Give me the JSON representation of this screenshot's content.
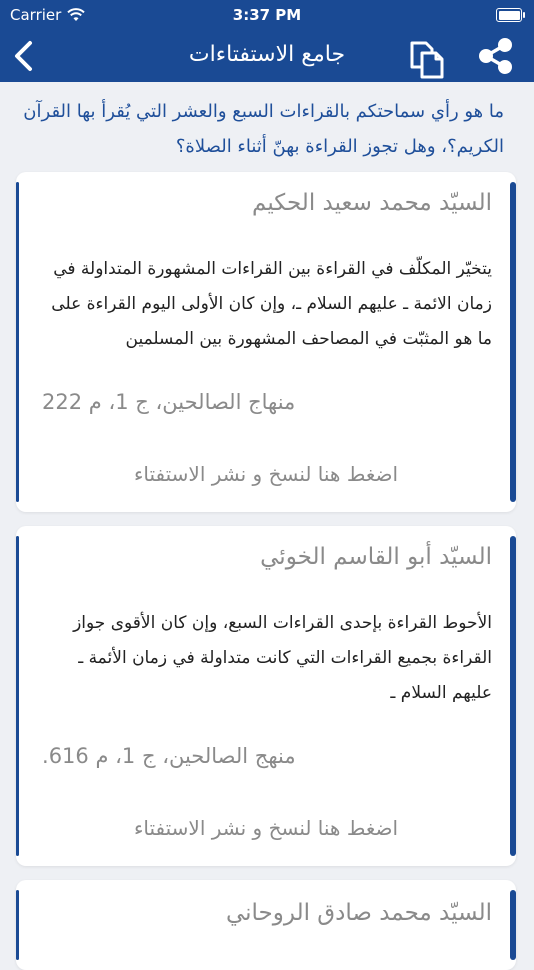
{
  "status": {
    "carrier": "Carrier",
    "time": "3:37 PM"
  },
  "nav": {
    "title": "جامع الاستفتاءات"
  },
  "question": "ما هو رأي سماحتكم بالقراءات السبع والعشر التي يُقرأ بها القرآن الكريم؟، وهل تجوز القراءة بهنّ أثناء الصلاة؟",
  "cards": [
    {
      "scholar": "السيّد محمد سعيد الحكيم",
      "answer": "يتخيّر المكلّف في القراءة بين القراءات المشهورة المتداولة في زمان الائمة ـ عليهم السلام ـ، وإن كان الأولى اليوم القراءة على ما هو المثبّت في المصاحف المشهورة بين المسلمين",
      "source": "منهاج الصالحين، ج 1، م 222",
      "copy_label": "اضغط هنا لنسخ و نشر الاستفتاء"
    },
    {
      "scholar": "السيّد أبو القاسم الخوئي",
      "answer": "الأحوط القراءة بإحدى القراءات السبع، وإن كان الأقوى جواز القراءة بجميع القراءات التي كانت متداولة في زمان الأئمة ـ عليهم السلام ـ",
      "source": "منهج الصالحين، ج 1، م 616.",
      "copy_label": "اضغط هنا لنسخ و نشر الاستفتاء"
    },
    {
      "scholar": "السيّد محمد صادق الروحاني"
    }
  ],
  "colors": {
    "header": "#1a4a94",
    "question": "#1f4f9a",
    "muted": "#8a8a8a"
  }
}
